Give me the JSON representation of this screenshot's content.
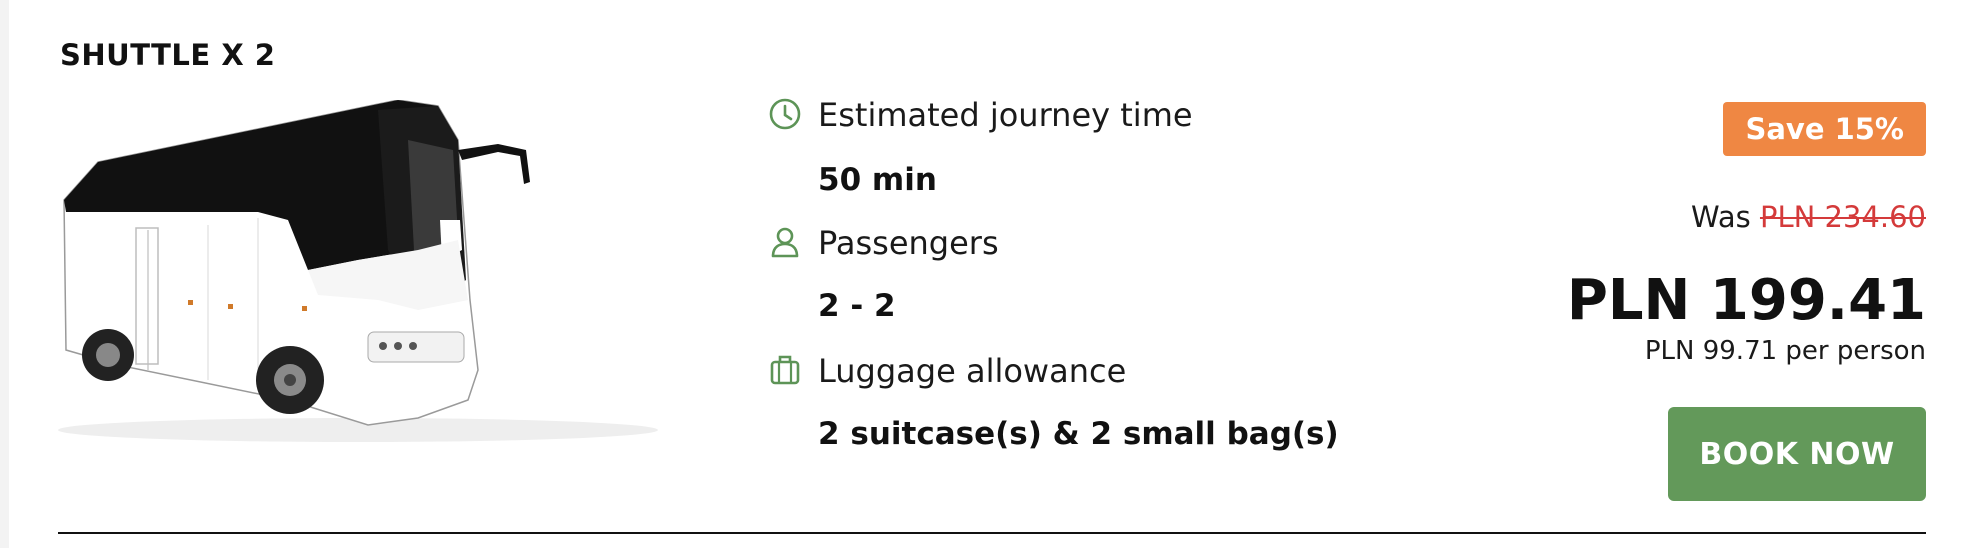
{
  "card": {
    "title": "SHUTTLE X 2",
    "image_alt": "white coach bus"
  },
  "details": {
    "journey_label": "Estimated journey time",
    "journey_value": "50 min",
    "passengers_label": "Passengers",
    "passengers_value": "2 - 2",
    "luggage_label": "Luggage allowance",
    "luggage_value": "2 suitcase(s) & 2 small bag(s)",
    "icons": [
      "clock-icon",
      "person-icon",
      "luggage-icon"
    ]
  },
  "pricing": {
    "save_badge": "Save 15%",
    "was_prefix": "Was",
    "was_price": "PLN 234.60",
    "total_price": "PLN 199.41",
    "per_person": "PLN 99.71 per person",
    "book_label": "BOOK NOW"
  },
  "colors": {
    "accent_green": "#63995a",
    "icon_green": "#5d9457",
    "badge_orange": "#ef8743",
    "strike_red": "#d43a3a"
  }
}
